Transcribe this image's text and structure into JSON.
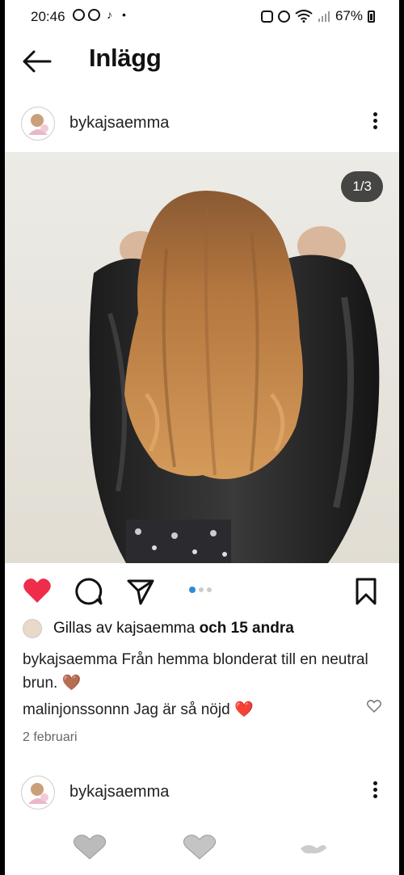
{
  "status_bar": {
    "time": "20:46",
    "battery": "67%",
    "more_dot": "•"
  },
  "header": {
    "title": "Inlägg"
  },
  "post": {
    "username": "bykajsaemma",
    "carousel_counter": "1/3",
    "carousel_position": 1,
    "carousel_total": 3,
    "liked": true,
    "likes": {
      "prefix": "Gillas av",
      "user": "kajsaemma",
      "conjunction": "och",
      "others": "15 andra"
    },
    "caption": {
      "username": "bykajsaemma",
      "text": "Från hemma blonderat till en neutral brun.",
      "emoji": "🤎"
    },
    "comment": {
      "username": "malinjonssonnn",
      "text": "Jag är så nöjd",
      "emoji": "❤️"
    },
    "date": "2 februari"
  },
  "next_post": {
    "username": "bykajsaemma"
  },
  "colors": {
    "like_red": "#ed2d49",
    "carousel_dot_active": "#2e8bd8",
    "background": "#ffffff"
  },
  "icons": [
    "back-arrow-icon",
    "more-options-icon",
    "heart-icon",
    "comment-icon",
    "share-icon",
    "bookmark-icon",
    "comment-heart-icon"
  ]
}
